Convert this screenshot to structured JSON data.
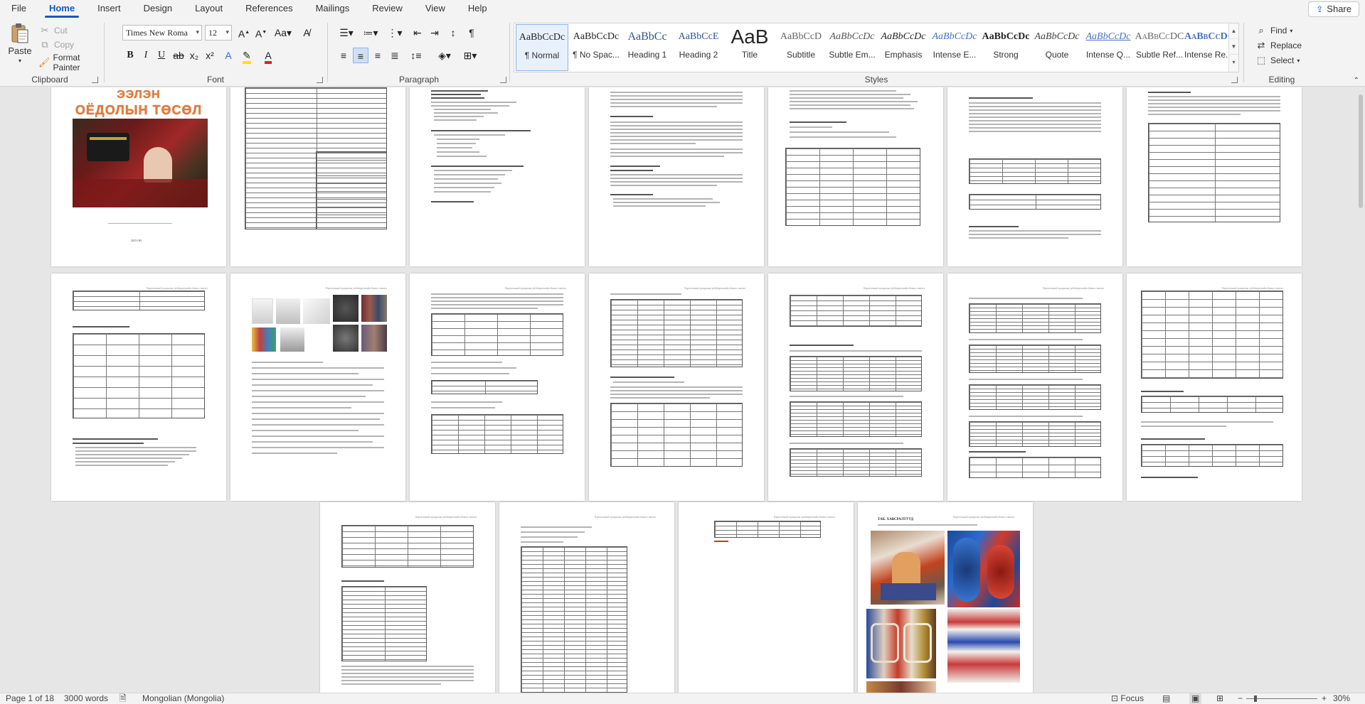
{
  "menu": {
    "tabs": [
      "File",
      "Home",
      "Insert",
      "Design",
      "Layout",
      "References",
      "Mailings",
      "Review",
      "View",
      "Help"
    ],
    "active": "Home",
    "share_label": "Share"
  },
  "clipboard": {
    "paste": "Paste",
    "cut": "Cut",
    "copy": "Copy",
    "format_painter": "Format Painter",
    "label": "Clipboard"
  },
  "font": {
    "name": "Times New Roma",
    "size": "12",
    "label": "Font"
  },
  "paragraph": {
    "label": "Paragraph"
  },
  "styles": {
    "label": "Styles",
    "items": [
      {
        "preview": "AaBbCcDc",
        "name": "¶ Normal"
      },
      {
        "preview": "AaBbCcDc",
        "name": "¶ No Spac..."
      },
      {
        "preview": "AaBbCc",
        "name": "Heading 1"
      },
      {
        "preview": "AaBbCcE",
        "name": "Heading 2"
      },
      {
        "preview": "AaB",
        "name": "Title"
      },
      {
        "preview": "AaBbCcD",
        "name": "Subtitle"
      },
      {
        "preview": "AaBbCcDc",
        "name": "Subtle Em..."
      },
      {
        "preview": "AaBbCcDc",
        "name": "Emphasis"
      },
      {
        "preview": "AaBbCcDc",
        "name": "Intense E..."
      },
      {
        "preview": "AaBbCcDc",
        "name": "Strong"
      },
      {
        "preview": "AaBbCcDc",
        "name": "Quote"
      },
      {
        "preview": "AaBbCcDc",
        "name": "Intense Q..."
      },
      {
        "preview": "AaBbCcDC",
        "name": "Subtle Ref..."
      },
      {
        "preview": "AaBbCcDC",
        "name": "Intense Re..."
      }
    ]
  },
  "editing": {
    "find": "Find",
    "replace": "Replace",
    "select": "Select",
    "label": "Editing"
  },
  "document": {
    "cover_title_1": "ЭЭЛЭН",
    "cover_title_2": "ОЁДОЛЫН ТӨСӨЛ",
    "cover_year": "2023 ОН",
    "page_header": "Хэрэглээний хувцасны үйлдвэрлэлийн бизнес төсөл",
    "references_heading": "ТАБ. ХАВСРАЛТУУД"
  },
  "status": {
    "page": "Page 1 of 18",
    "words": "3000 words",
    "language": "Mongolian (Mongolia)",
    "focus": "Focus",
    "zoom": "30%",
    "zoom_fraction": 0.3
  },
  "colors": {
    "accent": "#185abd",
    "cover_title": "#e07a3c"
  }
}
